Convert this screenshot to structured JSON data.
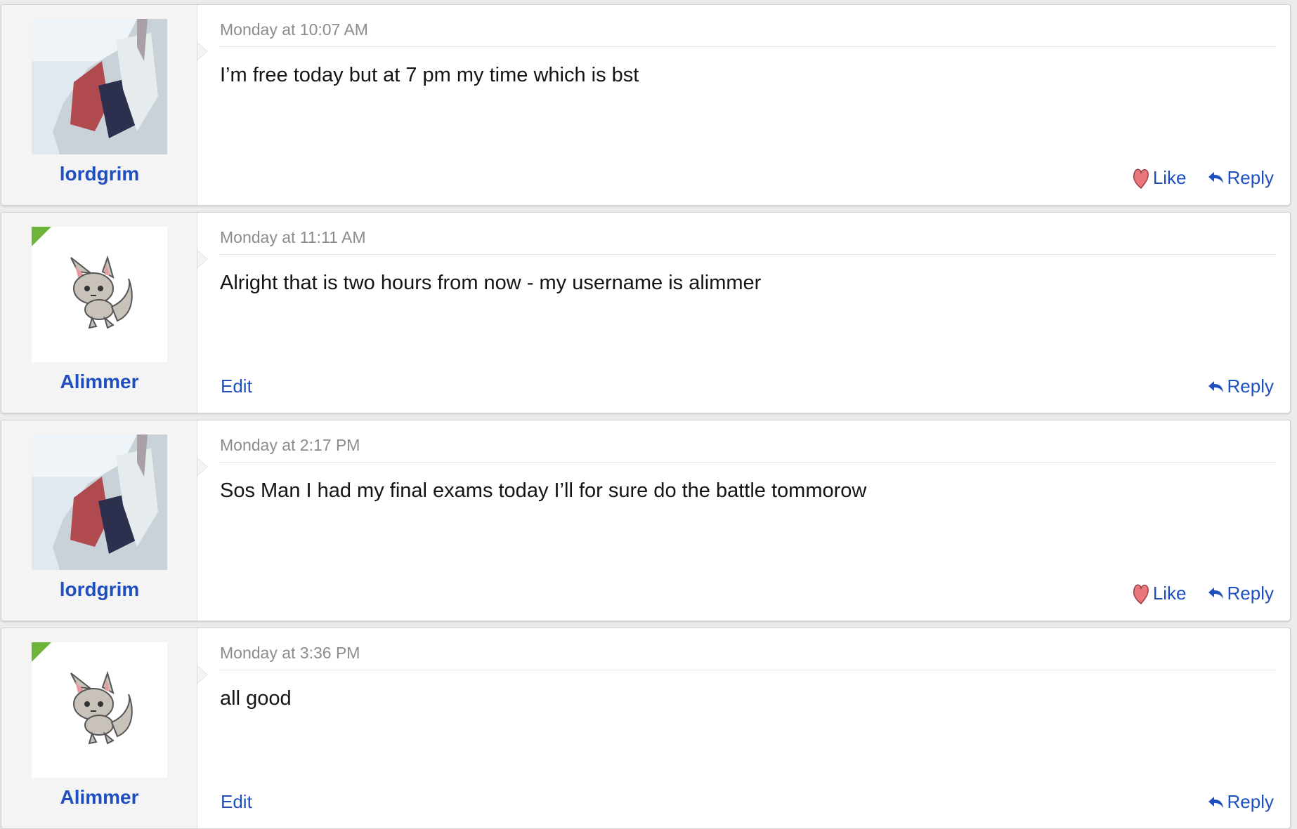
{
  "thread": {
    "posts": [
      {
        "username": "lordgrim",
        "avatar": "photo-avatar",
        "online": false,
        "timestamp": "Monday at 10:07 AM",
        "message": "I’m free today but at 7 pm my time which is bst",
        "actions_left": [],
        "actions_right": [
          {
            "label": "Like",
            "icon": "heart-icon"
          },
          {
            "label": "Reply",
            "icon": "reply-arrow-icon"
          }
        ]
      },
      {
        "username": "Alimmer",
        "avatar": "creature-avatar",
        "online": true,
        "timestamp": "Monday at 11:11 AM",
        "message": "Alright that is two hours from now - my username is alimmer",
        "actions_left": [
          {
            "label": "Edit"
          }
        ],
        "actions_right": [
          {
            "label": "Reply",
            "icon": "reply-arrow-icon"
          }
        ]
      },
      {
        "username": "lordgrim",
        "avatar": "photo-avatar",
        "online": false,
        "timestamp": "Monday at 2:17 PM",
        "message": "Sos Man I had my final exams today I’ll for sure do the battle tommorow",
        "actions_left": [],
        "actions_right": [
          {
            "label": "Like",
            "icon": "heart-icon"
          },
          {
            "label": "Reply",
            "icon": "reply-arrow-icon"
          }
        ]
      },
      {
        "username": "Alimmer",
        "avatar": "creature-avatar",
        "online": true,
        "timestamp": "Monday at 3:36 PM",
        "message": "all good",
        "actions_left": [
          {
            "label": "Edit"
          }
        ],
        "actions_right": [
          {
            "label": "Reply",
            "icon": "reply-arrow-icon"
          }
        ]
      }
    ]
  },
  "colors": {
    "link": "#1f4fbf",
    "online_flag": "#6db43a",
    "timestamp": "#8c8c8c",
    "like_heart": "#e8767a"
  }
}
